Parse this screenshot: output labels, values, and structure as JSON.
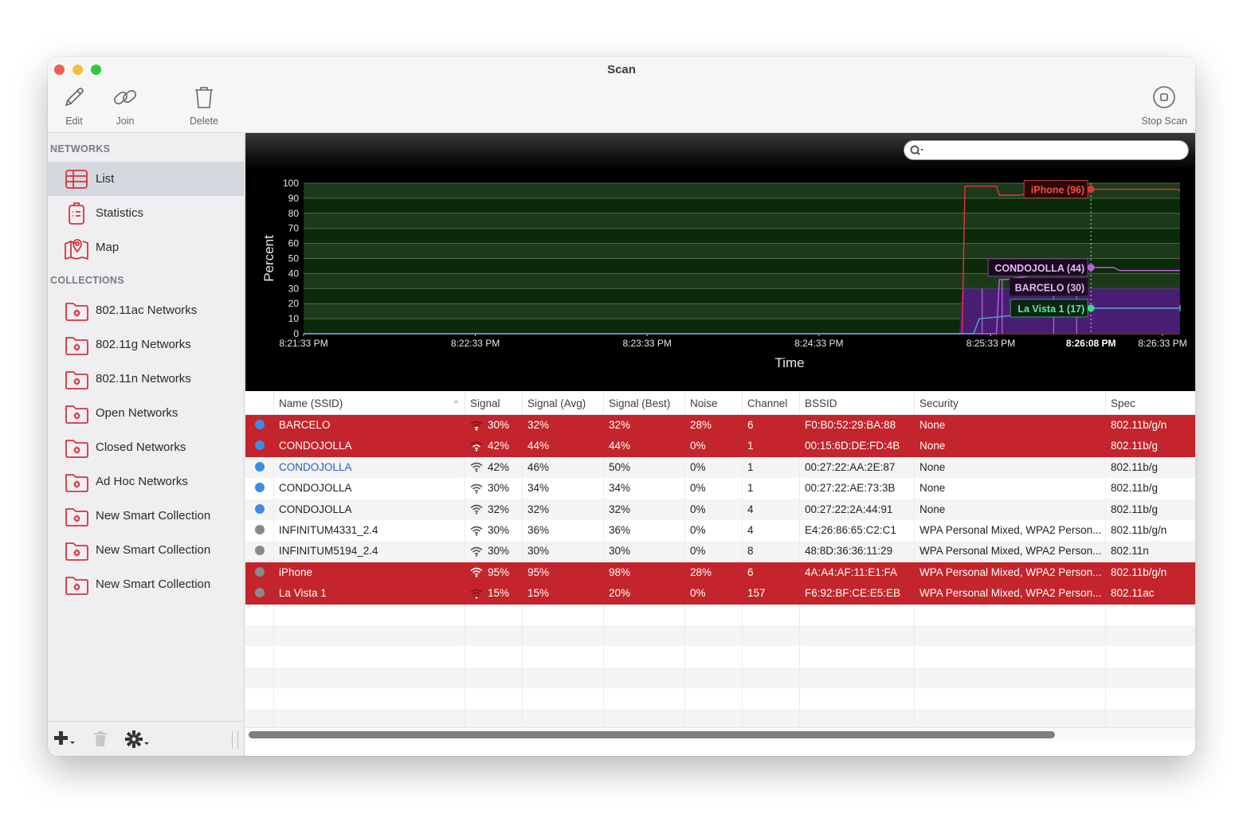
{
  "window": {
    "title": "Scan"
  },
  "toolbar": {
    "edit": "Edit",
    "join": "Join",
    "delete": "Delete",
    "stop_scan": "Stop Scan"
  },
  "sidebar": {
    "networks_header": "NETWORKS",
    "networks": [
      {
        "label": "List",
        "icon": "list-icon",
        "selected": true
      },
      {
        "label": "Statistics",
        "icon": "clipboard-icon",
        "selected": false
      },
      {
        "label": "Map",
        "icon": "map-pin-icon",
        "selected": false
      }
    ],
    "collections_header": "COLLECTIONS",
    "collections": [
      {
        "label": "802.11ac Networks",
        "icon": "smart-folder-icon"
      },
      {
        "label": "802.11g Networks",
        "icon": "smart-folder-icon"
      },
      {
        "label": "802.11n Networks",
        "icon": "smart-folder-icon"
      },
      {
        "label": "Open Networks",
        "icon": "smart-folder-icon"
      },
      {
        "label": "Closed Networks",
        "icon": "smart-folder-icon"
      },
      {
        "label": "Ad Hoc Networks",
        "icon": "smart-folder-icon"
      },
      {
        "label": "New Smart Collection",
        "icon": "smart-folder-icon"
      },
      {
        "label": "New Smart Collection",
        "icon": "smart-folder-icon"
      },
      {
        "label": "New Smart Collection",
        "icon": "smart-folder-icon"
      }
    ],
    "footer": {
      "add": "plus-icon",
      "delete": "trash-icon",
      "settings": "gear-icon"
    }
  },
  "search": {
    "placeholder": "",
    "value": ""
  },
  "colors": {
    "accent_red": "#c4242b",
    "sidebar_icon_red": "#d6343d",
    "link_blue": "#2d5bc9",
    "dot_blue": "#3b8ee8",
    "dot_gray": "#8a8a8a",
    "plot_green_dark": "#0b2a09",
    "plot_green_light": "#1c3a1a",
    "series_iphone": "#e3363a",
    "series_condojolla": "#c25ee0",
    "series_barcelo": "#a06ad8",
    "series_lavista": "#3ddc84"
  },
  "chart_data": {
    "type": "line",
    "title": "",
    "xlabel": "Time",
    "ylabel": "Percent",
    "ylim": [
      0,
      100
    ],
    "yticks": [
      0,
      10,
      20,
      30,
      40,
      50,
      60,
      70,
      80,
      90,
      100
    ],
    "xlim_seconds": [
      0,
      300
    ],
    "xticks": [
      {
        "t": 0,
        "label": "8:21:33 PM"
      },
      {
        "t": 60,
        "label": "8:22:33 PM"
      },
      {
        "t": 120,
        "label": "8:23:33 PM"
      },
      {
        "t": 180,
        "label": "8:24:33 PM"
      },
      {
        "t": 240,
        "label": "8:25:33 PM"
      },
      {
        "t": 300,
        "label": "8:26:33 PM"
      }
    ],
    "cursor": {
      "t": 275,
      "label": "8:26:08 PM"
    },
    "grid": true,
    "series": [
      {
        "name": "iPhone",
        "cursor_value": 96,
        "label": "iPhone (96)",
        "points": [
          [
            0,
            0
          ],
          [
            230,
            0
          ],
          [
            231,
            98
          ],
          [
            242,
            98
          ],
          [
            243,
            92
          ],
          [
            250,
            92
          ],
          [
            252,
            93
          ],
          [
            275,
            96
          ],
          [
            305,
            96
          ],
          [
            307,
            95
          ],
          [
            310,
            95
          ]
        ]
      },
      {
        "name": "CONDOJOLLA",
        "cursor_value": 44,
        "label": "CONDOJOLLA (44)",
        "points": [
          [
            0,
            0
          ],
          [
            242,
            0
          ],
          [
            243,
            36
          ],
          [
            245,
            36
          ],
          [
            275,
            44
          ],
          [
            283,
            44
          ],
          [
            285,
            42
          ],
          [
            310,
            42
          ]
        ]
      },
      {
        "name": "BARCELO",
        "cursor_value": 30,
        "label": "BARCELO (30)",
        "fill": true,
        "points": [
          [
            0,
            0
          ],
          [
            229,
            0
          ],
          [
            230,
            30
          ],
          [
            310,
            30
          ]
        ]
      },
      {
        "name": "La Vista 1",
        "cursor_value": 17,
        "label": "La Vista 1 (17)",
        "points": [
          [
            0,
            0
          ],
          [
            234,
            0
          ],
          [
            236,
            10
          ],
          [
            275,
            17
          ],
          [
            306,
            17
          ],
          [
            307,
            19
          ],
          [
            308,
            16
          ],
          [
            310,
            15
          ]
        ]
      }
    ]
  },
  "table": {
    "columns": [
      "",
      "Name (SSID)",
      "Signal",
      "Signal (Avg)",
      "Signal (Best)",
      "Noise",
      "Channel",
      "BSSID",
      "Security",
      "Spec"
    ],
    "sort_column": "Name (SSID)",
    "rows": [
      {
        "dot": "blue",
        "name": "BARCELO",
        "signal": "30%",
        "avg": "32%",
        "best": "32%",
        "noise": "28%",
        "channel": "6",
        "bssid": "F0:B0:52:29:BA:88",
        "security": "None",
        "spec": "802.11b/g/n",
        "highlight": true,
        "link": false
      },
      {
        "dot": "blue",
        "name": "CONDOJOLLA",
        "signal": "42%",
        "avg": "44%",
        "best": "44%",
        "noise": "0%",
        "channel": "1",
        "bssid": "00:15:6D:DE:FD:4B",
        "security": "None",
        "spec": "802.11b/g",
        "highlight": true,
        "link": false
      },
      {
        "dot": "blue",
        "name": "CONDOJOLLA",
        "signal": "42%",
        "avg": "46%",
        "best": "50%",
        "noise": "0%",
        "channel": "1",
        "bssid": "00:27:22:AA:2E:87",
        "security": "None",
        "spec": "802.11b/g",
        "highlight": false,
        "link": true
      },
      {
        "dot": "blue",
        "name": "CONDOJOLLA",
        "signal": "30%",
        "avg": "34%",
        "best": "34%",
        "noise": "0%",
        "channel": "1",
        "bssid": "00:27:22:AE:73:3B",
        "security": "None",
        "spec": "802.11b/g",
        "highlight": false,
        "link": false
      },
      {
        "dot": "blue",
        "name": "CONDOJOLLA",
        "signal": "32%",
        "avg": "32%",
        "best": "32%",
        "noise": "0%",
        "channel": "4",
        "bssid": "00:27:22:2A:44:91",
        "security": "None",
        "spec": "802.11b/g",
        "highlight": false,
        "link": false
      },
      {
        "dot": "gray",
        "name": "INFINITUM4331_2.4",
        "signal": "30%",
        "avg": "36%",
        "best": "36%",
        "noise": "0%",
        "channel": "4",
        "bssid": "E4:26:86:65:C2:C1",
        "security": "WPA Personal Mixed, WPA2 Person...",
        "spec": "802.11b/g/n",
        "highlight": false,
        "link": false
      },
      {
        "dot": "gray",
        "name": "INFINITUM5194_2.4",
        "signal": "30%",
        "avg": "30%",
        "best": "30%",
        "noise": "0%",
        "channel": "8",
        "bssid": "48:8D:36:36:11:29",
        "security": "WPA Personal Mixed, WPA2 Person...",
        "spec": "802.11n",
        "highlight": false,
        "link": false
      },
      {
        "dot": "gray",
        "name": "iPhone",
        "signal": "95%",
        "avg": "95%",
        "best": "98%",
        "noise": "28%",
        "channel": "6",
        "bssid": "4A:A4:AF:11:E1:FA",
        "security": "WPA Personal Mixed, WPA2 Person...",
        "spec": "802.11b/g/n",
        "highlight": true,
        "link": false
      },
      {
        "dot": "gray",
        "name": "La Vista 1",
        "signal": "15%",
        "avg": "15%",
        "best": "20%",
        "noise": "0%",
        "channel": "157",
        "bssid": "F6:92:BF:CE:E5:EB",
        "security": "WPA Personal Mixed, WPA2 Person...",
        "spec": "802.11ac",
        "highlight": true,
        "link": false
      }
    ],
    "empty_rows": 6
  }
}
